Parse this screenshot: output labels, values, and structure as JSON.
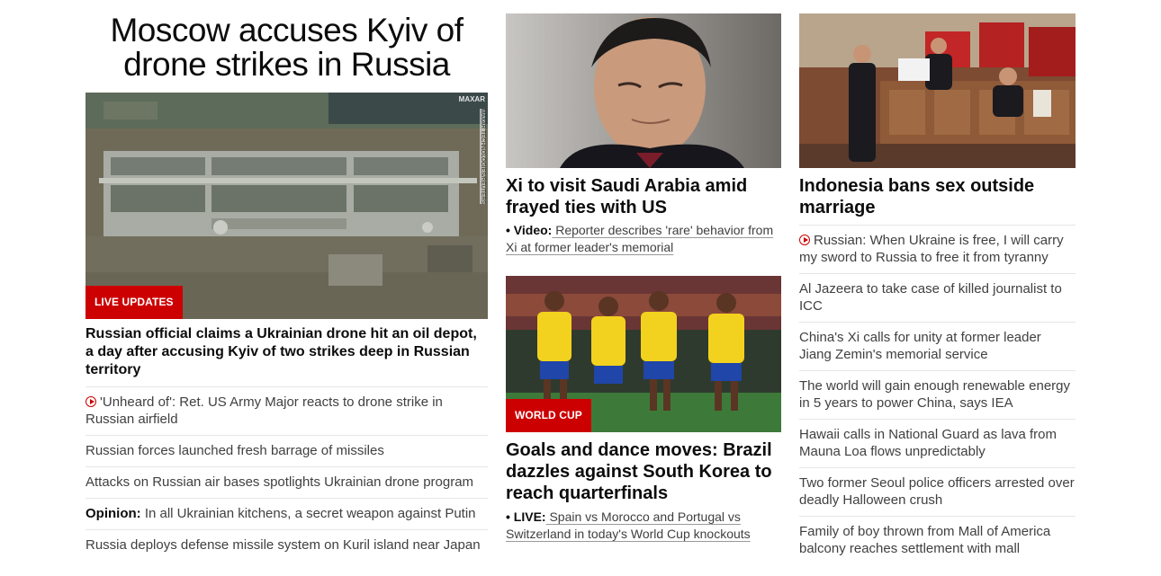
{
  "left": {
    "main_headline": "Moscow accuses Kyiv of drone strikes in Russia",
    "image": {
      "credit_top": "MAXAR",
      "credit_side": "MAXAR TECHNOLOGIES/REUTERS",
      "badge": "LIVE UPDATES"
    },
    "story_headline": "Russian official claims a Ukrainian drone hit an oil depot, a day after accusing Kyiv of two strikes deep in Russian territory",
    "items": [
      {
        "prefix": "",
        "text": "'Unheard of': Ret. US Army Major reacts to drone strike in Russian airfield",
        "icon": "play-icon"
      },
      {
        "prefix": "",
        "text": "Russian forces launched fresh barrage of missiles",
        "icon": ""
      },
      {
        "prefix": "",
        "text": "Attacks on Russian air bases spotlights Ukrainian drone program",
        "icon": ""
      },
      {
        "prefix": "Opinion:",
        "text": " In all Ukrainian kitchens, a secret weapon against Putin",
        "icon": ""
      },
      {
        "prefix": "",
        "text": "Russia deploys defense missile system on Kuril island near Japan",
        "icon": ""
      }
    ]
  },
  "middle": {
    "story1": {
      "headline": "Xi to visit Saudi Arabia amid frayed ties with US",
      "sub_prefix": "• Video:",
      "sub_text": " Reporter describes 'rare' behavior from Xi at former leader's memorial"
    },
    "story2": {
      "badge": "WORLD CUP",
      "headline": "Goals and dance moves: Brazil dazzles against South Korea to reach quarterfinals",
      "sub_prefix": "• LIVE:",
      "sub_text": " Spain vs Morocco and Portugal vs Switzerland in today's World Cup knockouts"
    }
  },
  "right": {
    "headline": "Indonesia bans sex outside marriage",
    "items": [
      {
        "text": "Russian: When Ukraine is free, I will carry my sword to Russia to free it from tyranny",
        "icon": "play-icon"
      },
      {
        "text": "Al Jazeera to take case of killed journalist to ICC",
        "icon": ""
      },
      {
        "text": "China's Xi calls for unity at former leader Jiang Zemin's memorial service",
        "icon": ""
      },
      {
        "text": "The world will gain enough renewable energy in 5 years to power China, says IEA",
        "icon": ""
      },
      {
        "text": "Hawaii calls in National Guard as lava from Mauna Loa flows unpredictably",
        "icon": ""
      },
      {
        "text": "Two former Seoul police officers arrested over deadly Halloween crush",
        "icon": ""
      },
      {
        "text": "Family of boy thrown from Mall of America balcony reaches settlement with mall",
        "icon": ""
      }
    ]
  },
  "colors": {
    "accent": "#cc0000",
    "text": "#0c0c0c",
    "muted": "#404040",
    "divider": "#e6e6e6"
  }
}
